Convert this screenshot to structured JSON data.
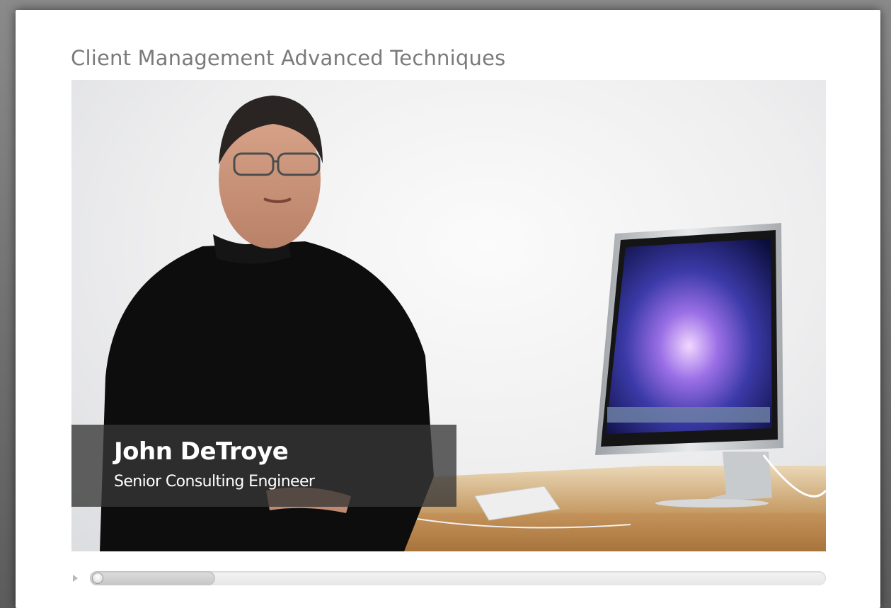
{
  "page": {
    "title": "Client Management Advanced Techniques"
  },
  "video": {
    "lower_third": {
      "name": "John DeTroye",
      "role": "Senior Consulting Engineer"
    }
  },
  "player": {
    "play_icon": "play-triangle",
    "loaded_fraction": 0.17,
    "position_fraction": 0.0
  }
}
